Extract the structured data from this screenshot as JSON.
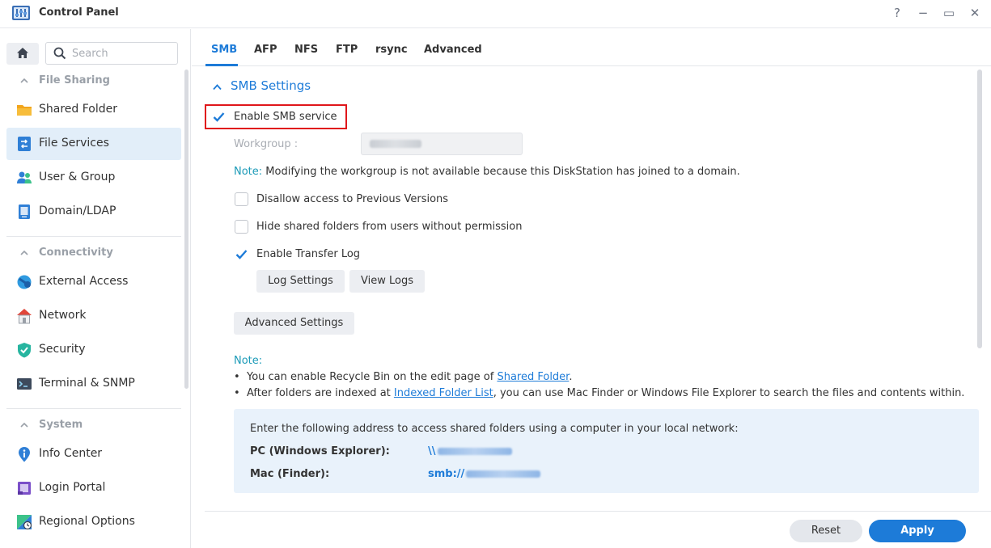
{
  "window": {
    "title": "Control Panel",
    "help_glyph": "?",
    "minimize_glyph": "−",
    "maximize_glyph": "▭",
    "close_glyph": "✕"
  },
  "sidebar": {
    "search_placeholder": "Search",
    "groups": [
      {
        "label": "File Sharing",
        "items": [
          {
            "label": "Shared Folder",
            "icon": "folder-icon"
          },
          {
            "label": "File Services",
            "icon": "file-services-icon",
            "active": true
          },
          {
            "label": "User & Group",
            "icon": "users-icon"
          },
          {
            "label": "Domain/LDAP",
            "icon": "domain-icon"
          }
        ]
      },
      {
        "label": "Connectivity",
        "items": [
          {
            "label": "External Access",
            "icon": "external-access-icon"
          },
          {
            "label": "Network",
            "icon": "network-house-icon"
          },
          {
            "label": "Security",
            "icon": "shield-icon"
          },
          {
            "label": "Terminal & SNMP",
            "icon": "terminal-icon"
          }
        ]
      },
      {
        "label": "System",
        "items": [
          {
            "label": "Info Center",
            "icon": "info-icon"
          },
          {
            "label": "Login Portal",
            "icon": "login-portal-icon"
          },
          {
            "label": "Regional Options",
            "icon": "regional-icon"
          }
        ]
      }
    ]
  },
  "tabs": [
    "SMB",
    "AFP",
    "NFS",
    "FTP",
    "rsync",
    "Advanced"
  ],
  "smb": {
    "section_title": "SMB Settings",
    "enable_label": "Enable SMB service",
    "workgroup_label": "Workgroup :",
    "note_key": "Note:",
    "note_text": " Modifying the workgroup is not available because this DiskStation has joined to a domain.",
    "options": [
      {
        "label": "Disallow access to Previous Versions",
        "checked": false
      },
      {
        "label": "Hide shared folders from users without permission",
        "checked": false
      },
      {
        "label": "Enable Transfer Log",
        "checked": true
      }
    ],
    "log_settings_label": "Log Settings",
    "view_logs_label": "View Logs",
    "advanced_settings_label": "Advanced Settings",
    "note2_title": "Note:",
    "bullet1_pre": "You can enable Recycle Bin on the edit page of ",
    "bullet1_link": "Shared Folder",
    "bullet1_post": ".",
    "bullet2_pre": "After folders are indexed at ",
    "bullet2_link": "Indexed Folder List",
    "bullet2_post": ", you can use Mac Finder or Windows File Explorer to search the files and contents within.",
    "access_intro": "Enter the following address to access shared folders using a computer in your local network:",
    "pc_label": "PC (Windows Explorer):",
    "pc_prefix": "\\\\",
    "mac_label": "Mac (Finder):",
    "mac_prefix": "smb://"
  },
  "footer": {
    "reset_label": "Reset",
    "apply_label": "Apply"
  },
  "colors": {
    "accent": "#1d7bd8",
    "highlight_border": "#e0161b",
    "note": "#1d9bb8"
  }
}
